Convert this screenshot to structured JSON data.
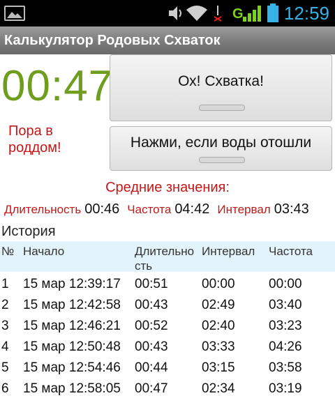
{
  "status_bar": {
    "time": "12:59",
    "icons": [
      "gallery-icon",
      "volume-icon",
      "wifi-icon",
      "data-off-icon",
      "signal-icon",
      "battery-icon"
    ],
    "signal_badge": "G"
  },
  "app": {
    "title": "Калькулятор Родовых Схваток"
  },
  "timer": {
    "value": "00:47"
  },
  "hint": {
    "text": "Пора в роддом!"
  },
  "buttons": {
    "contraction": "Ох! Схватка!",
    "water_broke": "Нажми, если воды отошли"
  },
  "averages": {
    "title": "Средние значения:",
    "items": [
      {
        "label": "Длительность",
        "value": "00:46"
      },
      {
        "label": "Частота",
        "value": "04:42"
      },
      {
        "label": "Интервал",
        "value": "03:43"
      }
    ]
  },
  "history": {
    "title": "История",
    "columns": [
      "№",
      "Начало",
      "Длительно\nсть",
      "Интервал",
      "Частота"
    ],
    "rows": [
      [
        "1",
        "15 мар 12:39:17",
        "00:51",
        "00:00",
        "00:00"
      ],
      [
        "2",
        "15 мар 12:42:58",
        "00:43",
        "02:49",
        "03:40"
      ],
      [
        "3",
        "15 мар 12:46:21",
        "00:52",
        "02:40",
        "03:23"
      ],
      [
        "4",
        "15 мар 12:50:48",
        "00:43",
        "03:33",
        "04:26"
      ],
      [
        "5",
        "15 мар 12:54:46",
        "00:44",
        "03:15",
        "03:58"
      ],
      [
        "6",
        "15 мар 12:58:05",
        "00:47",
        "02:34",
        "03:19"
      ]
    ]
  },
  "colors": {
    "timer": "#6f9d1e",
    "accent_red": "#c21818",
    "time_blue": "#36b2e6",
    "table_header": "#e3f3fb"
  }
}
